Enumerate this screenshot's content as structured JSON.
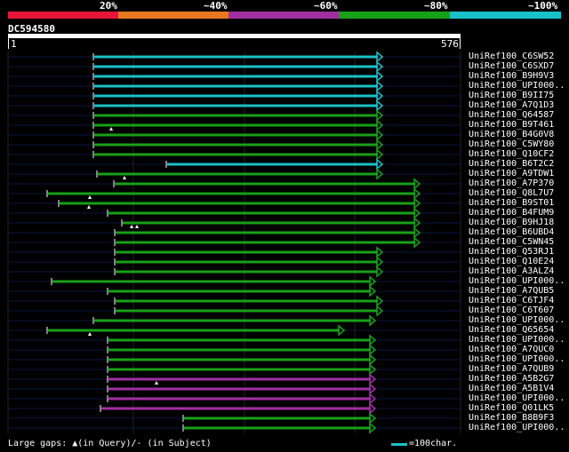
{
  "identity_legend": {
    "labels": [
      "20%",
      "~40%",
      "~60%",
      "~80%",
      "~100%"
    ],
    "colors": [
      "#e8153a",
      "#e87820",
      "#a030a0",
      "#18a018",
      "#19c1c8"
    ]
  },
  "query": {
    "name": "DC594580",
    "start": "1",
    "end": "576"
  },
  "hits": [
    {
      "name": "UniRef100_C6SW52",
      "start": 105,
      "end": 430,
      "color": "cyan"
    },
    {
      "name": "UniRef100_C6SXD7",
      "start": 105,
      "end": 430,
      "color": "cyan"
    },
    {
      "name": "UniRef100_B9H9V3",
      "start": 105,
      "end": 430,
      "color": "cyan"
    },
    {
      "name": "UniRef100_UPI000..",
      "start": 105,
      "end": 430,
      "color": "cyan"
    },
    {
      "name": "UniRef100_B9II75",
      "start": 105,
      "end": 430,
      "color": "cyan"
    },
    {
      "name": "UniRef100_A7Q1D3",
      "start": 105,
      "end": 430,
      "color": "cyan"
    },
    {
      "name": "UniRef100_Q64587",
      "start": 105,
      "end": 430,
      "color": "green"
    },
    {
      "name": "UniRef100_B9T461",
      "start": 105,
      "end": 430,
      "color": "green",
      "gaps": [
        125
      ]
    },
    {
      "name": "UniRef100_B4G0V8",
      "start": 105,
      "end": 430,
      "color": "green"
    },
    {
      "name": "UniRef100_C5WY80",
      "start": 105,
      "end": 430,
      "color": "green"
    },
    {
      "name": "UniRef100_Q10CF2",
      "start": 105,
      "end": 430,
      "color": "green"
    },
    {
      "name": "UniRef100_B6T2C2",
      "start": 187,
      "end": 430,
      "color": "cyan"
    },
    {
      "name": "UniRef100_A9TDW1",
      "start": 109,
      "end": 430,
      "color": "green",
      "gaps": [
        140
      ]
    },
    {
      "name": "UniRef100_A7P370",
      "start": 128,
      "end": 472,
      "color": "green"
    },
    {
      "name": "UniRef100_Q8L7U7",
      "start": 53,
      "end": 472,
      "color": "green",
      "gaps": [
        101
      ]
    },
    {
      "name": "UniRef100_B9ST01",
      "start": 66,
      "end": 472,
      "color": "green",
      "gaps": [
        100
      ]
    },
    {
      "name": "UniRef100_B4FUM9",
      "start": 121,
      "end": 472,
      "color": "green"
    },
    {
      "name": "UniRef100_B9HJ18",
      "start": 137,
      "end": 472,
      "color": "green",
      "gaps": [
        148,
        154
      ]
    },
    {
      "name": "UniRef100_B6UBD4",
      "start": 129,
      "end": 472,
      "color": "green"
    },
    {
      "name": "UniRef100_C5WN45",
      "start": 129,
      "end": 472,
      "color": "green"
    },
    {
      "name": "UniRef100_Q53RJ1",
      "start": 129,
      "end": 430,
      "color": "green"
    },
    {
      "name": "UniRef100_Q10E24",
      "start": 129,
      "end": 430,
      "color": "green"
    },
    {
      "name": "UniRef100_A3ALZ4",
      "start": 129,
      "end": 430,
      "color": "green"
    },
    {
      "name": "UniRef100_UPI000..",
      "start": 58,
      "end": 422,
      "color": "green"
    },
    {
      "name": "UniRef100_A7QUB5",
      "start": 121,
      "end": 422,
      "color": "green"
    },
    {
      "name": "UniRef100_C6TJF4",
      "start": 129,
      "end": 430,
      "color": "green"
    },
    {
      "name": "UniRef100_C6T607",
      "start": 129,
      "end": 430,
      "color": "green"
    },
    {
      "name": "UniRef100_UPI000..",
      "start": 105,
      "end": 422,
      "color": "green"
    },
    {
      "name": "UniRef100_Q65654",
      "start": 53,
      "end": 387,
      "color": "green",
      "gaps": [
        101
      ]
    },
    {
      "name": "UniRef100_UPI000..",
      "start": 121,
      "end": 422,
      "color": "green"
    },
    {
      "name": "UniRef100_A7QUC0",
      "start": 121,
      "end": 422,
      "color": "green"
    },
    {
      "name": "UniRef100_UPI000..",
      "start": 121,
      "end": 422,
      "color": "green"
    },
    {
      "name": "UniRef100_A7QUB9",
      "start": 121,
      "end": 422,
      "color": "green"
    },
    {
      "name": "UniRef100_A5B2G7",
      "start": 121,
      "end": 422,
      "color": "purple",
      "gaps": [
        176
      ]
    },
    {
      "name": "UniRef100_A5B1V4",
      "start": 121,
      "end": 422,
      "color": "purple"
    },
    {
      "name": "UniRef100_UPI000..",
      "start": 121,
      "end": 422,
      "color": "purple"
    },
    {
      "name": "UniRef100_Q01LK5",
      "start": 113,
      "end": 422,
      "color": "purple"
    },
    {
      "name": "UniRef100_B8B9F3",
      "start": 206,
      "end": 422,
      "color": "green"
    },
    {
      "name": "UniRef100_UPI000..",
      "start": 206,
      "end": 422,
      "color": "green"
    }
  ],
  "footer": {
    "gaps_text": "Large gaps: ▲(in Query)/- (in Subject)",
    "scale_text": "=100char."
  }
}
